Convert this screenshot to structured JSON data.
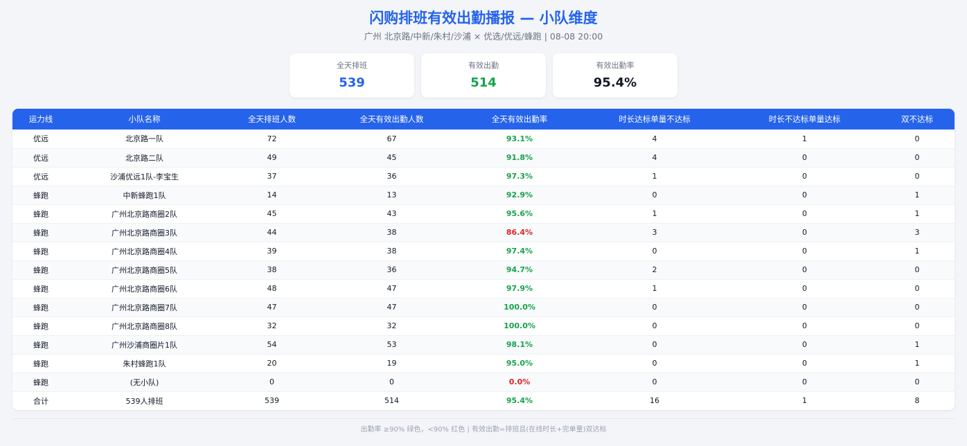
{
  "header": {
    "title": "闪购排班有效出勤播报 — 小队维度",
    "subtitle": "广州 北京路/中新/朱村/沙浦 × 优选/优远/蜂跑 | 08-08 20:00"
  },
  "summary": [
    {
      "label": "全天排班",
      "value": "539",
      "color": "#2563eb"
    },
    {
      "label": "有效出勤",
      "value": "514",
      "color": "#16a34a"
    },
    {
      "label": "有效出勤率",
      "value": "95.4%",
      "color": "#111827"
    }
  ],
  "table": {
    "columns": [
      "运力线",
      "小队名称",
      "全天排班人数",
      "全天有效出勤人数",
      "全天有效出勤率",
      "时长达标单量不达标",
      "时长不达标单量达标",
      "双不达标"
    ],
    "rows": [
      {
        "line": "优远",
        "team": "北京路一队",
        "scheduled": "72",
        "attended": "67",
        "rate": "93.1%",
        "status": "good",
        "a": "4",
        "b": "1",
        "c": "0"
      },
      {
        "line": "优远",
        "team": "北京路二队",
        "scheduled": "49",
        "attended": "45",
        "rate": "91.8%",
        "status": "good",
        "a": "4",
        "b": "0",
        "c": "0"
      },
      {
        "line": "优远",
        "team": "沙浦优远1队-李宝生",
        "scheduled": "37",
        "attended": "36",
        "rate": "97.3%",
        "status": "good",
        "a": "1",
        "b": "0",
        "c": "0"
      },
      {
        "line": "蜂跑",
        "team": "中新蜂跑1队",
        "scheduled": "14",
        "attended": "13",
        "rate": "92.9%",
        "status": "good",
        "a": "0",
        "b": "0",
        "c": "1"
      },
      {
        "line": "蜂跑",
        "team": "广州北京路商圈2队",
        "scheduled": "45",
        "attended": "43",
        "rate": "95.6%",
        "status": "good",
        "a": "1",
        "b": "0",
        "c": "1"
      },
      {
        "line": "蜂跑",
        "team": "广州北京路商圈3队",
        "scheduled": "44",
        "attended": "38",
        "rate": "86.4%",
        "status": "bad",
        "a": "3",
        "b": "0",
        "c": "3"
      },
      {
        "line": "蜂跑",
        "team": "广州北京路商圈4队",
        "scheduled": "39",
        "attended": "38",
        "rate": "97.4%",
        "status": "good",
        "a": "0",
        "b": "0",
        "c": "1"
      },
      {
        "line": "蜂跑",
        "team": "广州北京路商圈5队",
        "scheduled": "38",
        "attended": "36",
        "rate": "94.7%",
        "status": "good",
        "a": "2",
        "b": "0",
        "c": "0"
      },
      {
        "line": "蜂跑",
        "team": "广州北京路商圈6队",
        "scheduled": "48",
        "attended": "47",
        "rate": "97.9%",
        "status": "good",
        "a": "1",
        "b": "0",
        "c": "0"
      },
      {
        "line": "蜂跑",
        "team": "广州北京路商圈7队",
        "scheduled": "47",
        "attended": "47",
        "rate": "100.0%",
        "status": "good",
        "a": "0",
        "b": "0",
        "c": "0"
      },
      {
        "line": "蜂跑",
        "team": "广州北京路商圈8队",
        "scheduled": "32",
        "attended": "32",
        "rate": "100.0%",
        "status": "good",
        "a": "0",
        "b": "0",
        "c": "0"
      },
      {
        "line": "蜂跑",
        "team": "广州沙浦商圈片1队",
        "scheduled": "54",
        "attended": "53",
        "rate": "98.1%",
        "status": "good",
        "a": "0",
        "b": "0",
        "c": "1"
      },
      {
        "line": "蜂跑",
        "team": "朱村蜂跑1队",
        "scheduled": "20",
        "attended": "19",
        "rate": "95.0%",
        "status": "good",
        "a": "0",
        "b": "0",
        "c": "1"
      },
      {
        "line": "蜂跑",
        "team": "(无小队)",
        "scheduled": "0",
        "attended": "0",
        "rate": "0.0%",
        "status": "bad",
        "a": "0",
        "b": "0",
        "c": "0"
      }
    ],
    "total": {
      "line": "合计",
      "team": "539人排班",
      "scheduled": "539",
      "attended": "514",
      "rate": "95.4%",
      "status": "good",
      "a": "16",
      "b": "1",
      "c": "8"
    }
  },
  "colors": {
    "accent": "#2563eb",
    "good": "#16a34a",
    "bad": "#dc2626"
  },
  "footer": {
    "note": "出勤率 ≥90% 绿色，<90% 红色 | 有效出勤=排班且(在线时长+完单量)双达标"
  }
}
